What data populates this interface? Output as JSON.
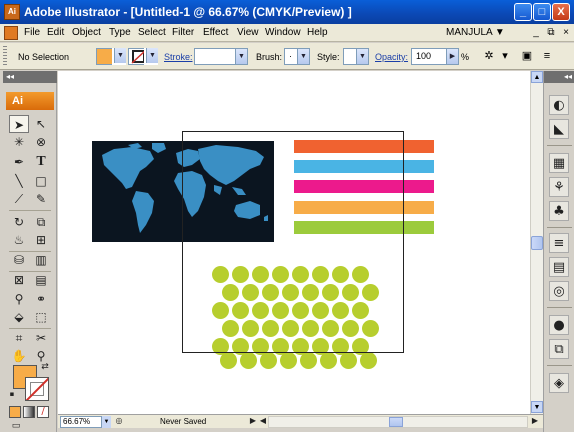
{
  "window": {
    "app_icon": "Ai",
    "title": "Adobe Illustrator - [Untitled-1 @ 66.67% (CMYK/Preview) ]",
    "minimize": "_",
    "maximize": "□",
    "close": "X"
  },
  "menubar": {
    "items": [
      "File",
      "Edit",
      "Object",
      "Type",
      "Select",
      "Filter",
      "Effect",
      "View",
      "Window",
      "Help"
    ],
    "user": "MANJULA ▼",
    "doc_controls": [
      "_",
      "⧉",
      "×"
    ]
  },
  "controlbar": {
    "selection": "No Selection",
    "fill_color": "#f7ac48",
    "stroke_label": "Stroke:",
    "brush_label": "Brush:",
    "brush_value": "·",
    "style_label": "Style:",
    "opacity_label": "Opacity:",
    "opacity_value": "100",
    "percent": "%"
  },
  "tools": {
    "badge": "Ai",
    "fill_color": "#f7ac48",
    "stroke_color": "none"
  },
  "canvas": {
    "stripe_colors": [
      "#f06230",
      "#4ab4e4",
      "#ec1a8c",
      "#f7ac48",
      "#9ccb3c"
    ],
    "dot_color": "#b7ce2e",
    "map_land_color": "#3a8fc4",
    "map_bg_color": "#0b1520"
  },
  "statusbar": {
    "zoom": "66.67%",
    "status": "Never Saved"
  }
}
